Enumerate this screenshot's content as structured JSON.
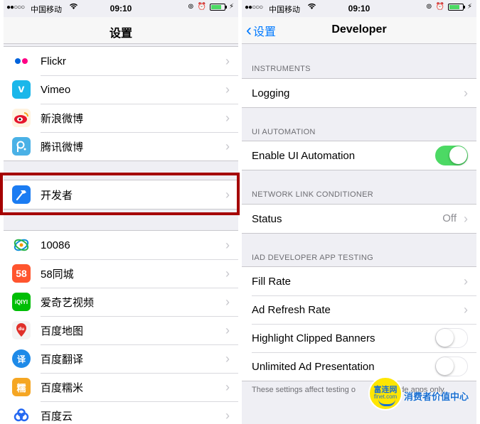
{
  "status_bar": {
    "signal": "●●○○○",
    "carrier": "中国移动",
    "time": "09:10",
    "battery_percent": 80
  },
  "left": {
    "title": "设置",
    "group1": [
      {
        "label": "Flickr",
        "icon": "flickr-icon"
      },
      {
        "label": "Vimeo",
        "icon": "vimeo-icon"
      },
      {
        "label": "新浪微博",
        "icon": "weibo-icon"
      },
      {
        "label": "腾讯微博",
        "icon": "tencent-weibo-icon"
      }
    ],
    "developer": {
      "label": "开发者",
      "icon": "developer-hammer-icon"
    },
    "group3": [
      {
        "label": "10086",
        "icon": "china-mobile-icon"
      },
      {
        "label": "58同城",
        "icon": "58-icon",
        "icon_text": "58"
      },
      {
        "label": "爱奇艺视频",
        "icon": "iqiyi-icon",
        "icon_text": "iQIYI"
      },
      {
        "label": "百度地图",
        "icon": "baidu-map-icon",
        "icon_text": "du"
      },
      {
        "label": "百度翻译",
        "icon": "baidu-translate-icon",
        "icon_text": "译"
      },
      {
        "label": "百度糯米",
        "icon": "baidu-nuomi-icon",
        "icon_text": "糯"
      },
      {
        "label": "百度云",
        "icon": "baidu-cloud-icon"
      }
    ]
  },
  "right": {
    "back_label": "设置",
    "title": "Developer",
    "sections": {
      "instruments": {
        "header": "INSTRUMENTS",
        "logging": "Logging"
      },
      "ui_automation": {
        "header": "UI AUTOMATION",
        "enable": "Enable UI Automation",
        "enabled": true
      },
      "nlc": {
        "header": "NETWORK LINK CONDITIONER",
        "status": "Status",
        "status_value": "Off"
      },
      "iad": {
        "header": "IAD DEVELOPER APP TESTING",
        "fill_rate": "Fill Rate",
        "ad_refresh": "Ad Refresh Rate",
        "highlight": "Highlight Clipped Banners",
        "highlight_on": false,
        "unlimited": "Unlimited Ad Presentation",
        "unlimited_on": false
      }
    },
    "footer": "These settings affect testing o           er-mode apps only."
  },
  "watermark": {
    "badge_title": "富连网",
    "badge_sub": "flnet.com",
    "text": "消费者价值中心"
  },
  "colors": {
    "accent": "#007aff",
    "toggle_on": "#4cd964",
    "highlight_border": "#a50000"
  }
}
